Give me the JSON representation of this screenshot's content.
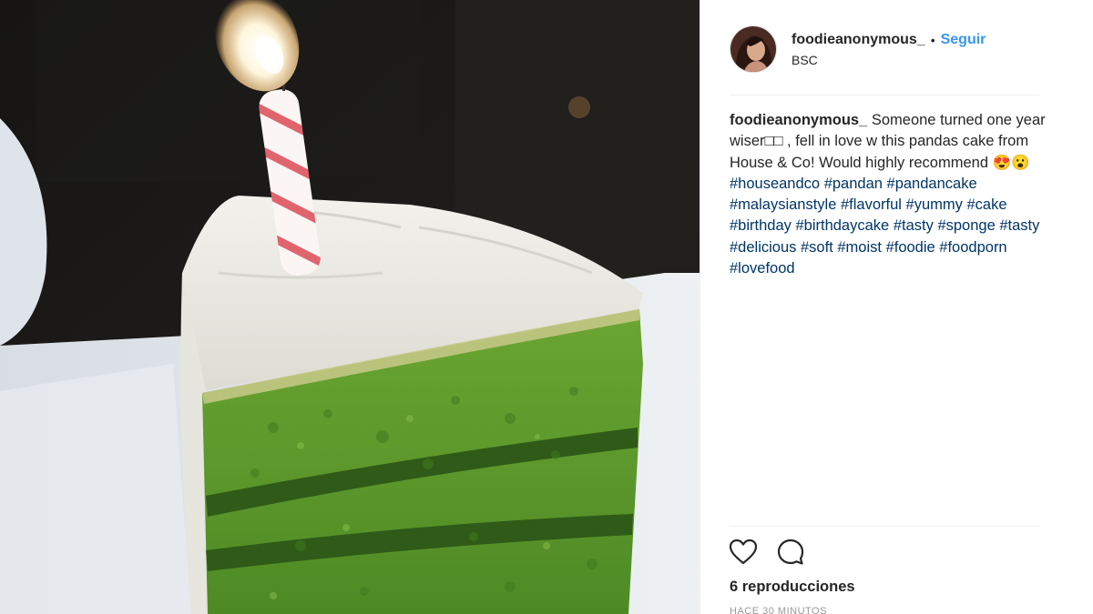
{
  "post": {
    "username": "foodieanonymous_",
    "separator": "•",
    "follow_label": "Seguir",
    "location": "BSC"
  },
  "caption": {
    "username": "foodieanonymous_",
    "text": " Someone turned one year wiser□□ , fell in love w this pandas cake from House & Co! Would highly recommend 😍😮",
    "hashtags": [
      "#houseandco",
      "#pandan",
      "#pandancake",
      "#malaysianstyle",
      "#flavorful",
      "#yummy",
      "#cake",
      "#birthday",
      "#birthdaycake",
      "#tasty",
      "#sponge",
      "#tasty",
      "#delicious",
      "#soft",
      "#moist",
      "#foodie",
      "#foodporn",
      "#lovefood"
    ]
  },
  "actions": {
    "like_icon": "heart-icon",
    "comment_icon": "comment-icon"
  },
  "stats": {
    "views": "6 reproducciones",
    "time": "HACE 30 MINUTOS"
  },
  "colors": {
    "link": "#3897f0",
    "hashtag": "#003569",
    "cake_green": "#5a9a2a",
    "frosting": "#ecebe5"
  }
}
